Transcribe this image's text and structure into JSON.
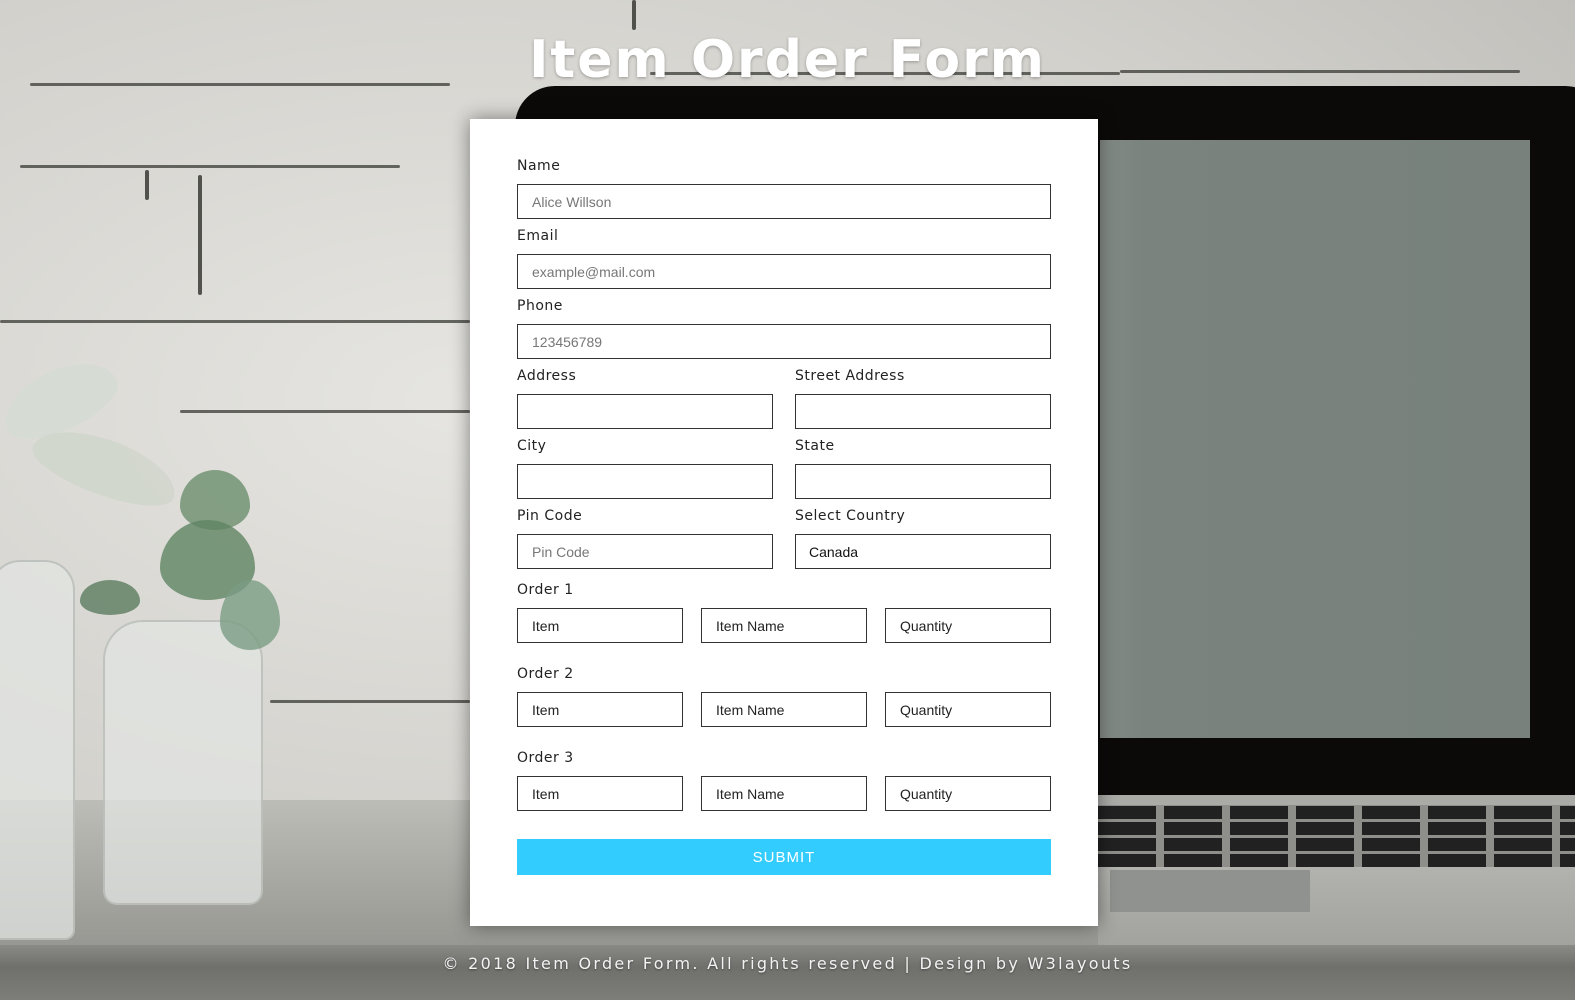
{
  "page": {
    "title": "Item Order Form"
  },
  "form": {
    "fields": {
      "name": {
        "label": "Name",
        "placeholder": "Alice Willson",
        "value": ""
      },
      "email": {
        "label": "Email",
        "placeholder": "example@mail.com",
        "value": ""
      },
      "phone": {
        "label": "Phone",
        "placeholder": "123456789",
        "value": ""
      },
      "address": {
        "label": "Address",
        "placeholder": "",
        "value": ""
      },
      "street_address": {
        "label": "Street Address",
        "placeholder": "",
        "value": ""
      },
      "city": {
        "label": "City",
        "placeholder": "",
        "value": ""
      },
      "state": {
        "label": "State",
        "placeholder": "",
        "value": ""
      },
      "pin_code": {
        "label": "Pin Code",
        "placeholder": "Pin Code",
        "value": ""
      },
      "country": {
        "label": "Select Country",
        "selected": "Canada"
      }
    },
    "orders": [
      {
        "label": "Order 1",
        "item_placeholder": "Item",
        "item_name_placeholder": "Item Name",
        "quantity_placeholder": "Quantity"
      },
      {
        "label": "Order 2",
        "item_placeholder": "Item",
        "item_name_placeholder": "Item Name",
        "quantity_placeholder": "Quantity"
      },
      {
        "label": "Order 3",
        "item_placeholder": "Item",
        "item_name_placeholder": "Item Name",
        "quantity_placeholder": "Quantity"
      }
    ],
    "submit_label": "SUBMIT"
  },
  "footer": {
    "copyright": "© 2018 Item Order Form. All rights reserved | Design by ",
    "designer_link": "W3layouts"
  },
  "colors": {
    "accent": "#33ccff",
    "input_border": "#333333",
    "title_text": "#ffffff"
  }
}
